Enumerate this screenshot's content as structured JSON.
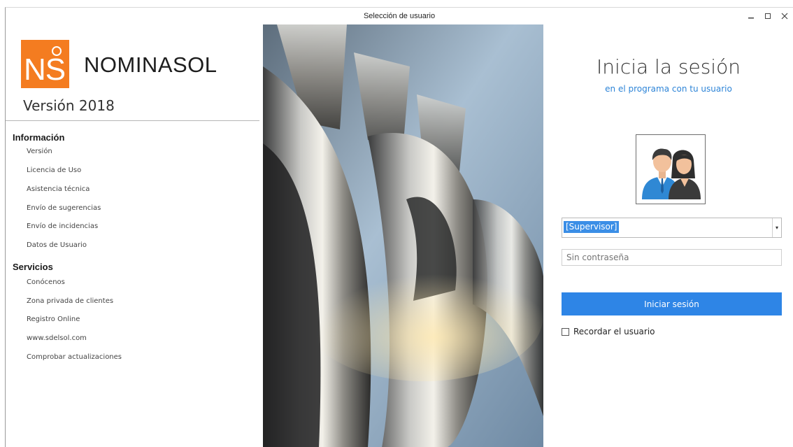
{
  "window": {
    "title": "Selección de usuario"
  },
  "brand": {
    "logo_text": "NS",
    "name": "NOMINASOL",
    "version": "Versión 2018"
  },
  "sections": [
    {
      "title": "Información",
      "items": [
        "Versión",
        "Licencia de Uso",
        "Asistencia técnica",
        "Envío de sugerencias",
        "Envío de incidencias",
        "Datos de Usuario"
      ]
    },
    {
      "title": "Servicios",
      "items": [
        "Conócenos",
        "Zona privada de clientes",
        "Registro Online",
        "www.sdelsol.com",
        "Comprobar actualizaciones"
      ]
    }
  ],
  "login": {
    "title": "Inicia la sesión",
    "subtitle": "en el programa con tu usuario",
    "user_selected": "[Supervisor]",
    "password_placeholder": "Sin contraseña",
    "submit_label": "Iniciar sesión",
    "remember_label": "Recordar el usuario"
  },
  "colors": {
    "brand_orange": "#f47c20",
    "accent_blue": "#2e85e6",
    "link_blue": "#2d84d7"
  },
  "icons": [
    "minimize-icon",
    "maximize-icon",
    "close-icon",
    "users-avatar-icon",
    "dropdown-arrow-icon",
    "checkbox-icon"
  ]
}
